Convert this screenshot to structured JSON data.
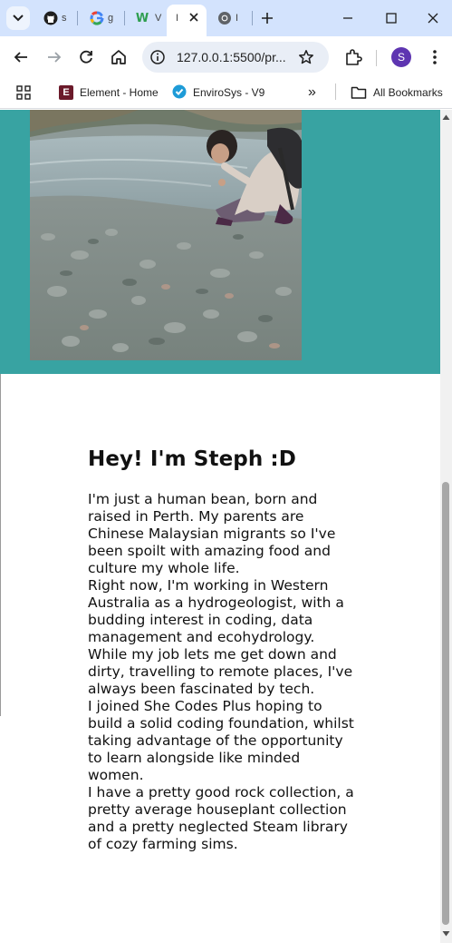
{
  "browser": {
    "tabs": [
      {
        "icon": "github-icon",
        "title": "s"
      },
      {
        "icon": "google-icon",
        "title": "g"
      },
      {
        "icon": "w-icon",
        "title": "V"
      },
      {
        "icon": "page-icon",
        "title": "I",
        "active": true
      },
      {
        "icon": "chrome-icon",
        "title": "I"
      }
    ],
    "url": "127.0.0.1:5500/pr...",
    "profile_initial": "S",
    "bookmarks": [
      {
        "icon": "element-icon",
        "label": "Element - Home",
        "icon_letter": "E"
      },
      {
        "icon": "envirosys-check-icon",
        "label": "EnviroSys - V9"
      }
    ],
    "bookmarks_overflow": "»",
    "all_bookmarks_label": "All Bookmarks"
  },
  "page": {
    "heading": "Hey! I'm Steph :D",
    "paragraphs": [
      "I'm just a human bean, born and raised in Perth. My parents are Chinese Malaysian migrants so I've been spoilt with amazing food and culture my whole life.",
      "Right now, I'm working in Western Australia as a hydrogeologist, with a budding interest in coding, data management and ecohydrology. While my job lets me get down and dirty, travelling to remote places, I've always been fascinated by tech.",
      "I joined She Codes Plus hoping to build a solid coding foundation, whilst taking advantage of the opportunity to learn alongside like minded women.",
      "I have a pretty good rock collection, a pretty average houseplant collection and a pretty neglected Steam library of cozy farming sims."
    ]
  },
  "colors": {
    "tabstrip": "#d3e3fd",
    "hero_bg": "#38a3a2",
    "profile": "#5e35b1"
  }
}
